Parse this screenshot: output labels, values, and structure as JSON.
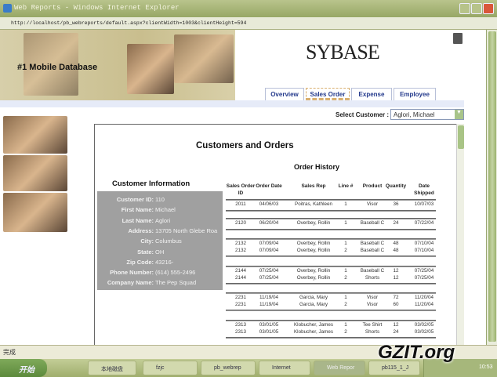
{
  "window": {
    "title": "Web Reports - Windows Internet Explorer",
    "url": "http://localhost/pb_webreports/default.aspx?clientWidth=1003&clientHeight=594"
  },
  "banner": {
    "tagline": "#1 Mobile Database",
    "logo": "SYBASE"
  },
  "tabs": [
    {
      "label": "Overview"
    },
    {
      "label": "Sales Order",
      "active": true
    },
    {
      "label": "Expense"
    },
    {
      "label": "Employee"
    }
  ],
  "select_customer": {
    "label": "Select Customer :",
    "value": "Aglori, Michael"
  },
  "report": {
    "title": "Customers and Orders",
    "history_title": "Order History",
    "info_title": "Customer Information"
  },
  "customer": [
    {
      "key": "Customer ID:",
      "value": "110"
    },
    {
      "key": "First Name:",
      "value": "Michael"
    },
    {
      "key": "Last Name:",
      "value": "Aglori"
    },
    {
      "key": "Address:",
      "value": "13705 North Glebe Roa"
    },
    {
      "key": "City:",
      "value": "Columbus"
    },
    {
      "key": "State:",
      "value": "OH"
    },
    {
      "key": "Zip Code:",
      "value": "43216-"
    },
    {
      "key": "Phone Number:",
      "value": "(614) 555-2496"
    },
    {
      "key": "Company Name:",
      "value": "The Pep Squad"
    }
  ],
  "columns": [
    "Sales Order ID",
    "Order Date",
    "Sales Rep",
    "Line #",
    "Product",
    "Quantity",
    "Date Shipped"
  ],
  "order_groups": [
    [
      [
        "2011",
        "04/06/03",
        "Poitras, Kathleen",
        "1",
        "Visor",
        "36",
        "10/07/03"
      ]
    ],
    [
      [
        "2120",
        "06/20/04",
        "Overbey, Rollin",
        "1",
        "Baseball C",
        "24",
        "07/22/04"
      ]
    ],
    [
      [
        "2132",
        "07/09/04",
        "Overbey, Rollin",
        "1",
        "Baseball C",
        "48",
        "07/10/04"
      ],
      [
        "2132",
        "07/09/04",
        "Overbey, Rollin",
        "2",
        "Baseball C",
        "48",
        "07/10/04"
      ]
    ],
    [
      [
        "2144",
        "07/25/04",
        "Overbey, Rollin",
        "1",
        "Baseball C",
        "12",
        "07/25/04"
      ],
      [
        "2144",
        "07/25/04",
        "Overbey, Rollin",
        "2",
        "Shorts",
        "12",
        "07/25/04"
      ]
    ],
    [
      [
        "2231",
        "11/19/04",
        "Garcia, Mary",
        "1",
        "Visor",
        "72",
        "11/20/04"
      ],
      [
        "2231",
        "11/19/04",
        "Garcia, Mary",
        "2",
        "Visor",
        "60",
        "11/20/04"
      ]
    ],
    [
      [
        "2313",
        "03/01/05",
        "Klobucher, James",
        "1",
        "Tee Shirt",
        "12",
        "03/02/05"
      ],
      [
        "2313",
        "03/01/05",
        "Klobucher, James",
        "2",
        "Shorts",
        "24",
        "03/02/05"
      ]
    ]
  ],
  "status": {
    "text": "完成"
  },
  "taskbar": {
    "start": "开始",
    "items": [
      "本地磁盘",
      "fzjc",
      "pb_webrep",
      "Internet",
      "Web Repor",
      "pb115_1_J"
    ],
    "clock": "10:53"
  },
  "watermark": "GZIT.org"
}
